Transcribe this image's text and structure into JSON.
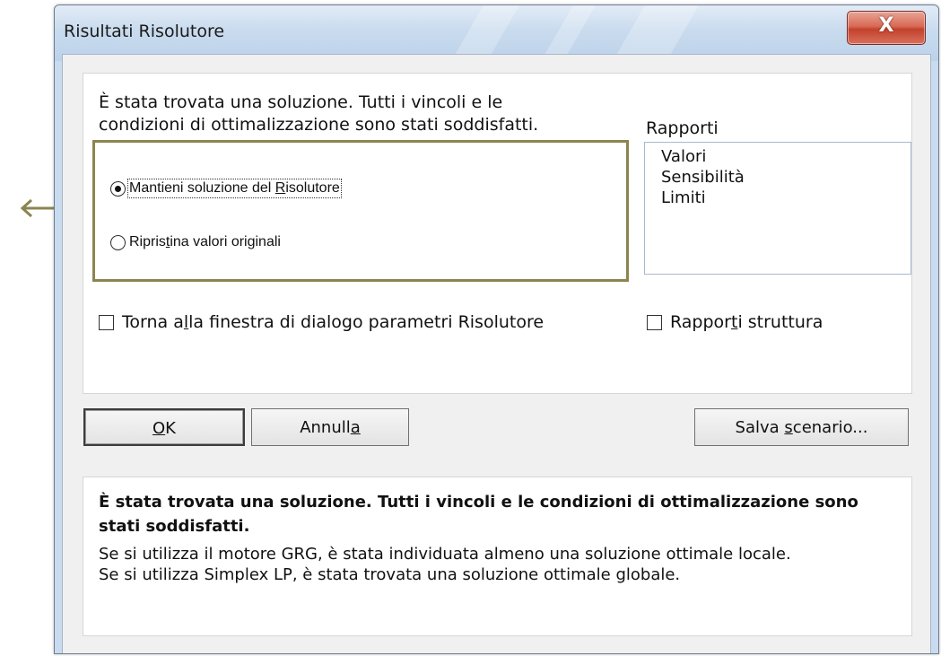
{
  "window": {
    "title": "Risultati Risolutore",
    "close_label": "X"
  },
  "message_lines": [
    "È stata trovata una soluzione. Tutti i vincoli e le",
    "condizioni di ottimalizzazione sono stati soddisfatti."
  ],
  "radios": [
    {
      "before": "Mantieni soluzione del ",
      "hot": "R",
      "after": "isolutore",
      "checked": true
    },
    {
      "before": "Ripris",
      "hot": "t",
      "after": "ina valori originali",
      "checked": false
    }
  ],
  "reports": {
    "label": "Rapporti",
    "items": [
      "Valori",
      "Sensibilità",
      "Limiti"
    ]
  },
  "checkboxes": {
    "return_dialog": {
      "before": "Torna a",
      "hot": "l",
      "after": "la finestra di dialogo parametri Risolutore",
      "checked": false
    },
    "outline_reports": {
      "before": "Rappor",
      "hot": "t",
      "after": "i struttura",
      "checked": false
    }
  },
  "buttons": {
    "ok": {
      "before": "",
      "hot": "O",
      "after": "K"
    },
    "cancel": {
      "before": "Annull",
      "hot": "a",
      "after": ""
    },
    "save_scenario": {
      "before": "Salva ",
      "hot": "s",
      "after": "cenario..."
    }
  },
  "help": {
    "bold": "È stata trovata una soluzione. Tutti i vincoli e le condizioni di ottimalizzazione sono stati soddisfatti.",
    "lines": [
      "Se si utilizza il motore GRG, è stata individuata almeno una soluzione ottimale locale.",
      "Se si utilizza Simplex LP, è stata trovata una soluzione ottimale globale."
    ]
  },
  "colors": {
    "highlight_border": "#8c8450",
    "close_button": "#c2422c",
    "title_bar": "#c9dbee"
  },
  "icons": {
    "annotation": "left-arrow-icon",
    "close": "close-icon"
  }
}
